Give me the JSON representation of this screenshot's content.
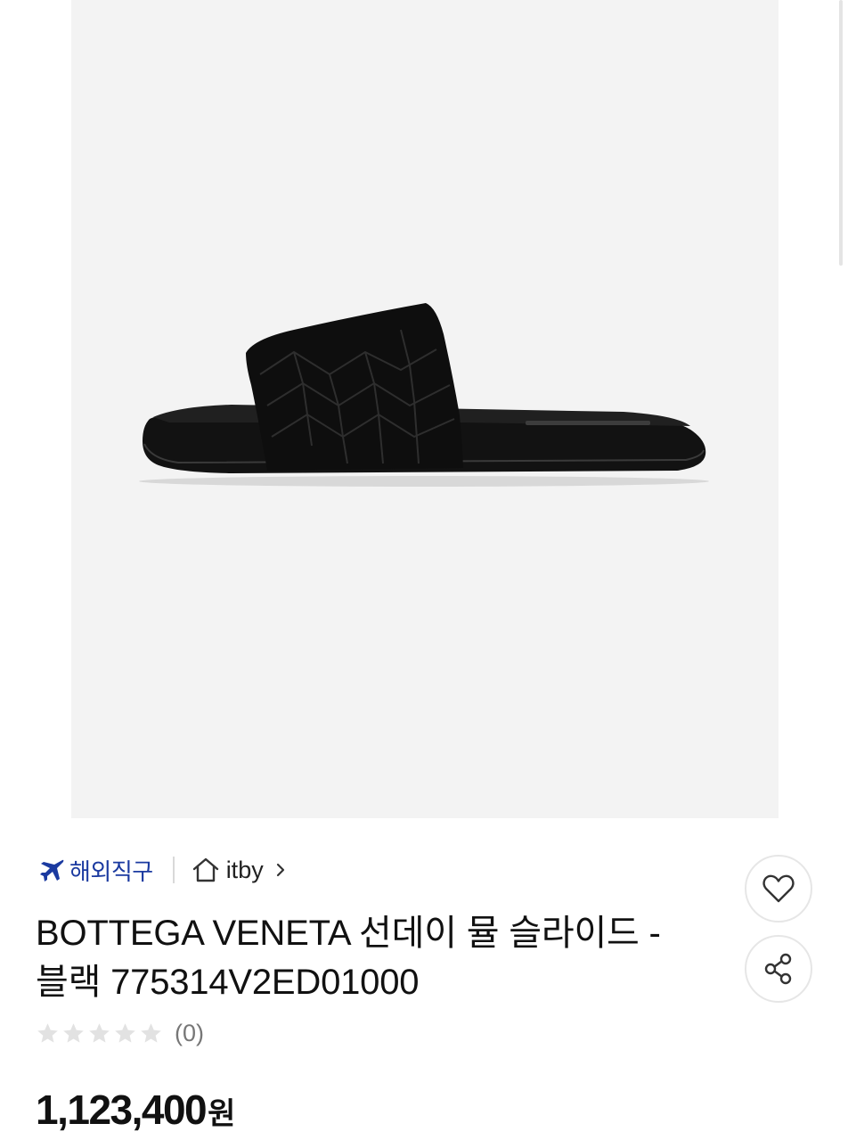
{
  "product": {
    "image_alt": "BOTTEGA VENETA 선데이 뮬 슬라이드 블랙",
    "badge": {
      "label": "해외직구",
      "icon": "airplane-icon",
      "color": "#1b3aa0"
    },
    "store": {
      "name": "itby",
      "icon": "home-icon",
      "chevron": "chevron-right-icon"
    },
    "title": "BOTTEGA VENETA 선데이 뮬 슬라이드 - 블랙 775314V2ED01000",
    "rating": {
      "stars": 0,
      "max": 5,
      "count_label": "(0)"
    },
    "price": {
      "value": "1,123,400",
      "unit": "원"
    },
    "actions": {
      "like_icon": "heart-icon",
      "share_icon": "share-icon"
    }
  }
}
